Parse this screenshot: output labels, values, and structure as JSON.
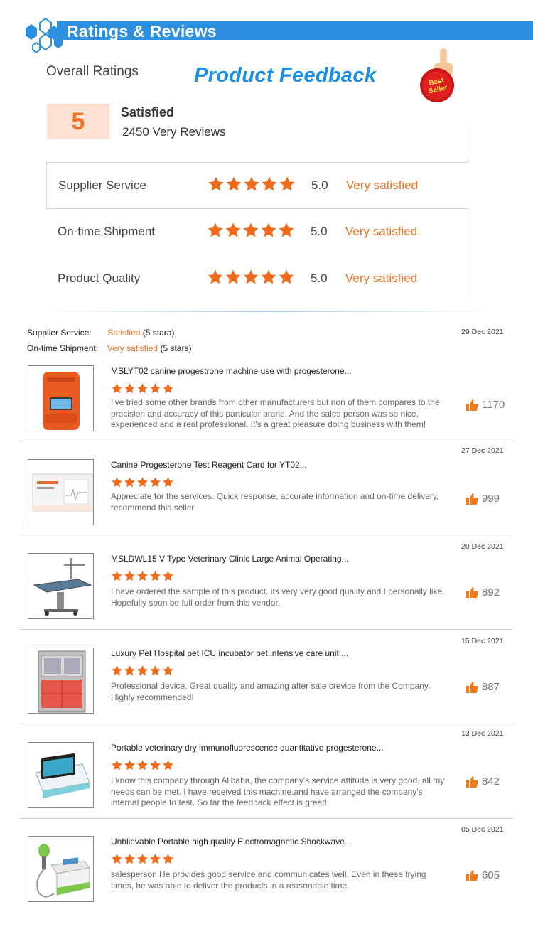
{
  "header": {
    "title": "Ratings & Reviews",
    "overall_label": "Overall Ratings",
    "feedback_title": "Product Feedback",
    "badge_line1": "Best",
    "badge_line2": "Seller"
  },
  "summary": {
    "score": "5",
    "satisfied_label": "Satisfied",
    "reviews_count": "2450  Very Reviews"
  },
  "ratings": [
    {
      "label": "Supplier Service",
      "stars": 5,
      "score": "5.0",
      "text": "Very satisfied"
    },
    {
      "label": "On-time Shipment",
      "stars": 5,
      "score": "5.0",
      "text": "Very satisfied"
    },
    {
      "label": "Product Quality",
      "stars": 5,
      "score": "5.0",
      "text": "Very satisfied"
    }
  ],
  "meta": {
    "supplier_label": "Supplier Service:",
    "supplier_value": "Satisfied",
    "supplier_suffix": "(5 stara)",
    "shipment_label": "On-time Shipment:",
    "shipment_value": "Very satisfied",
    "shipment_suffix": "(5 stars)",
    "date": "29 Dec 2021"
  },
  "reviews": [
    {
      "title": "MSLYT02 canine progestrone machine use with progesterone...",
      "stars": 5,
      "text": "I've tried some other brands from other manufacturers but non of them compares to the precision and accuracy of this particular brand. And the sales person was so nice, experienced and a real professional. It's a great pleasure doing business with them!",
      "likes": "1170",
      "date": "",
      "image": "orange-analyzer"
    },
    {
      "title": "Canine Progesterone Test Reagent Card for YT02...",
      "stars": 5,
      "text": "Appreciate for the services. Quick response, accurate information and on-time delivery, recommend this seller",
      "likes": "999",
      "date": "27 Dec 2021",
      "image": "reagent-card"
    },
    {
      "title": "MSLDWL15 V Type Veterinary Clinic Large Animal Operating...",
      "stars": 5,
      "text": "I have ordered the sample of this product. its very very good quality and I personally like. Hopefully soon be full order from this vendor.",
      "likes": "892",
      "date": "20 Dec 2021",
      "image": "operating-table"
    },
    {
      "title": "Luxury Pet Hospital pet ICU incubator pet intensive care unit ...",
      "stars": 5,
      "text": "Professional device. Great quality and amazing after sale crevice from the Company. Highly recommended!",
      "likes": "887",
      "date": "15 Dec 2021",
      "image": "icu-incubator"
    },
    {
      "title": "Portable veterinary dry immunofluorescence quantitative progesterone...",
      "stars": 5,
      "text": "I know this company through Alibaba, the company's service attitude is very good, all my needs can be met. I have received this machine,and have arranged the company's internal people to test. So far the feedback effect is great!",
      "likes": "842",
      "date": "13 Dec 2021",
      "image": "immuno-analyzer"
    },
    {
      "title": "Unblievable Portable high quality Electromagnetic Shockwave...",
      "stars": 5,
      "text": "salesperson He provides good service and communicates well. Even in these trying times, he was able to deliver the products in a reasonable time.",
      "likes": "605",
      "date": "05 Dec 2021",
      "image": "shockwave-device"
    }
  ],
  "colors": {
    "accent_blue": "#2c8fe0",
    "star_orange": "#f06a1c",
    "text_orange": "#f07020",
    "score_bg": "#fde2d3"
  }
}
